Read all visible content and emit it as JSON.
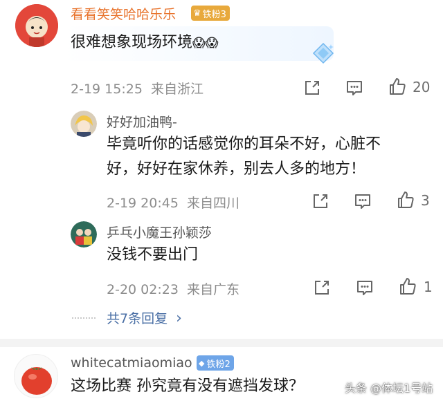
{
  "comments": [
    {
      "user": "看看笑笑哈哈乐乐",
      "badge": "铁粉3",
      "text": "很难想象现场环境",
      "emoji": "😱😱",
      "date": "2-19 15:25",
      "location": "来自浙江",
      "likes": "20"
    },
    {
      "replies": [
        {
          "user": "好好加油鸭-",
          "text_line1": "毕竟听你的话感觉你的耳朵不好，心脏不",
          "text_line2": "好，好好在家休养，别去人多的地方！",
          "date": "2-19 20:45",
          "location": "来自四川",
          "likes": "3"
        },
        {
          "user": "乒乓小魔王孙颖莎",
          "text": "没钱不要出门",
          "date": "2-20 02:23",
          "location": "来自广东",
          "likes": "1"
        }
      ],
      "more_replies": "共7条回复",
      "more_chevron": "›"
    },
    {
      "user": "whitecatmiaomiao",
      "badge": "铁粉2",
      "text": "这场比赛  孙究竟有没有遮挡发球？"
    }
  ],
  "watermark": "头条 @体坛1号站",
  "colors": {
    "username_orange": "#e8732c",
    "username_gray": "#555555",
    "badge_gold": "#e8a93c",
    "badge_blue": "#6ea5e8",
    "meta_gray": "#8c8c8c"
  },
  "icons": [
    "share-icon",
    "comment-icon",
    "like-icon",
    "diamond-icon"
  ]
}
